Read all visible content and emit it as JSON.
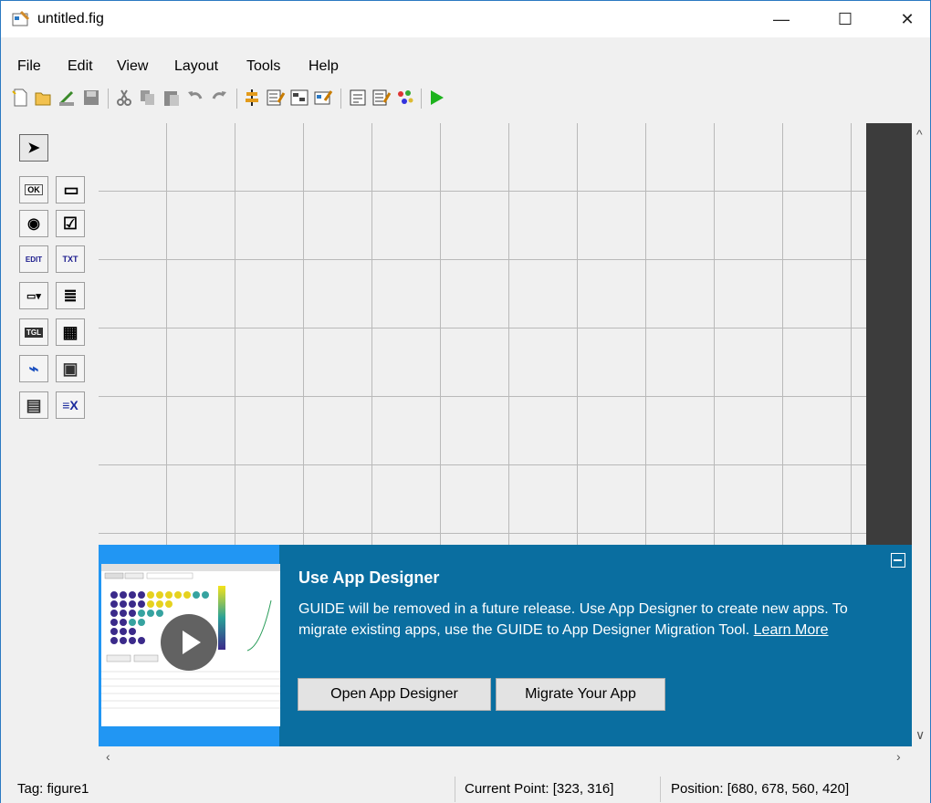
{
  "window": {
    "title": "untitled.fig",
    "minimize_glyph": "—",
    "maximize_glyph": "☐",
    "close_glyph": "✕"
  },
  "menu": [
    "File",
    "Edit",
    "View",
    "Layout",
    "Tools",
    "Help"
  ],
  "toolbar": {
    "icons": [
      "new-file-icon",
      "open-file-icon",
      "export-icon",
      "save-icon",
      "cut-icon",
      "copy-icon",
      "paste-icon",
      "undo-icon",
      "redo-icon",
      "align-objects-icon",
      "menu-editor-icon",
      "tab-order-editor-icon",
      "toolbar-editor-icon",
      "editor-icon",
      "property-inspector-icon",
      "object-browser-icon",
      "run-figure-icon"
    ]
  },
  "palette": {
    "items": [
      {
        "name": "select-tool",
        "glyph": "➤"
      },
      {
        "name": "push-button-tool",
        "glyph": "OK"
      },
      {
        "name": "slider-tool",
        "glyph": "▭"
      },
      {
        "name": "radio-button-tool",
        "glyph": "◉"
      },
      {
        "name": "checkbox-tool",
        "glyph": "☑"
      },
      {
        "name": "edit-text-tool",
        "glyph": "EDIT"
      },
      {
        "name": "static-text-tool",
        "glyph": "TXT"
      },
      {
        "name": "popup-menu-tool",
        "glyph": "▭▾"
      },
      {
        "name": "listbox-tool",
        "glyph": "≣"
      },
      {
        "name": "toggle-button-tool",
        "glyph": "TGL"
      },
      {
        "name": "table-tool",
        "glyph": "▦"
      },
      {
        "name": "axes-tool",
        "glyph": "⌁"
      },
      {
        "name": "panel-tool",
        "glyph": "▣"
      },
      {
        "name": "button-group-tool",
        "glyph": "▤"
      },
      {
        "name": "activex-tool",
        "glyph": "≡X"
      }
    ]
  },
  "banner": {
    "title": "Use App Designer",
    "text": "GUIDE will be removed in a future release. Use App Designer to create new apps. To migrate existing apps, use the GUIDE to App Designer Migration Tool.",
    "link": "Learn More",
    "open_button": "Open App Designer",
    "migrate_button": "Migrate Your App"
  },
  "status": {
    "tag": "Tag: figure1",
    "current_point": "Current Point:  [323, 316]",
    "position": "Position: [680, 678, 560, 420]"
  },
  "colors": {
    "banner_bg": "#0a6ea0",
    "thumbnail_bg": "#2196f3",
    "run_green": "#1db31d"
  }
}
